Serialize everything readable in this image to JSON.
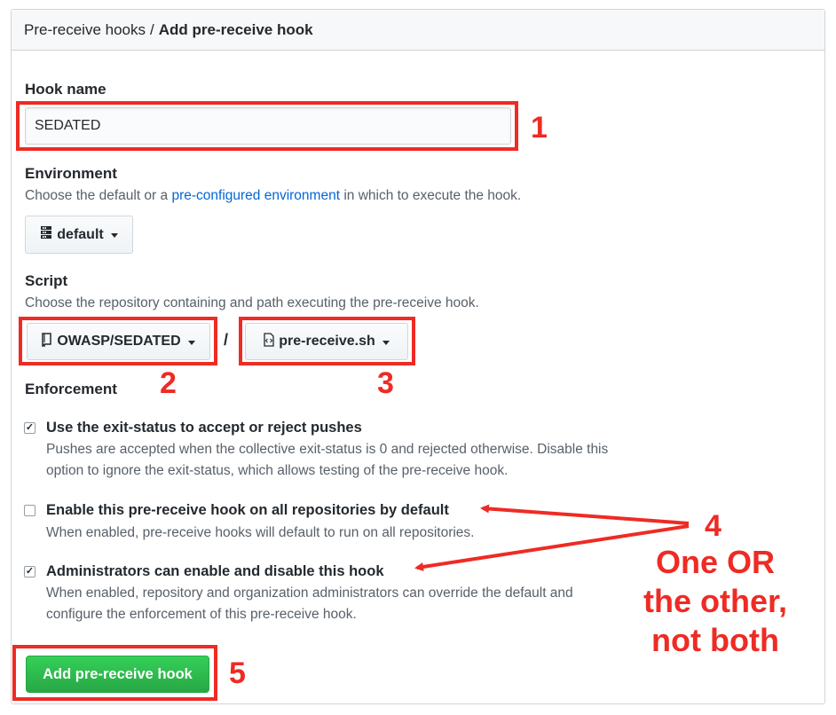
{
  "breadcrumb": {
    "parent": "Pre-receive hooks",
    "separator": "/",
    "current": "Add pre-receive hook"
  },
  "hook_name": {
    "label": "Hook name",
    "value": "SEDATED"
  },
  "environment": {
    "label": "Environment",
    "note_before": "Choose the default or a ",
    "note_link": "pre-configured environment",
    "note_after": " in which to execute the hook.",
    "button_label": "default",
    "icon": "server-icon"
  },
  "script": {
    "label": "Script",
    "note": "Choose the repository containing and path executing the pre-receive hook.",
    "repo_button": "OWASP/SEDATED",
    "repo_icon": "repo-icon",
    "separator": "/",
    "file_button": "pre-receive.sh",
    "file_icon": "file-code-icon"
  },
  "enforcement": {
    "label": "Enforcement",
    "options": [
      {
        "title": "Use the exit-status to accept or reject pushes",
        "desc_line1": "Pushes are accepted when the collective exit-status is 0 and rejected otherwise. Disable this",
        "desc_line2": "option to ignore the exit-status, which allows testing of the pre-receive hook.",
        "checked": true
      },
      {
        "title": "Enable this pre-receive hook on all repositories by default",
        "desc_line1": "When enabled, pre-receive hooks will default to run on all repositories.",
        "desc_line2": "",
        "checked": false
      },
      {
        "title": "Administrators can enable and disable this hook",
        "desc_line1": "When enabled, repository and organization administrators can override the default and",
        "desc_line2": "configure the enforcement of this pre-receive hook.",
        "checked": true
      }
    ]
  },
  "submit_button": "Add pre-receive hook",
  "annotations": {
    "n1": "1",
    "n2": "2",
    "n3": "3",
    "n4": "4",
    "n5": "5",
    "note_line1": "One OR",
    "note_line2": "the other,",
    "note_line3": "not both",
    "color": "#ee2b24"
  },
  "colors": {
    "primary_green": "#28a745",
    "link_blue": "#0366d6",
    "annotation_red": "#ee2b24"
  }
}
